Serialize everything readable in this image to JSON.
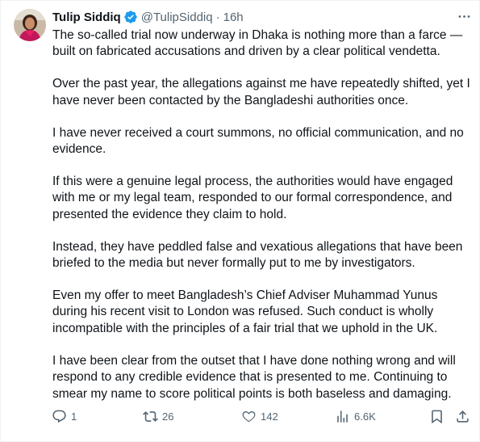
{
  "author": {
    "name": "Tulip Siddiq",
    "handle": "@TulipSiddiq",
    "separator": "·",
    "time": "16h",
    "verified": true
  },
  "icons": {
    "avatar": "profile-photo",
    "verified": "verified-badge-icon",
    "more": "more-options-icon",
    "reply": "reply-icon",
    "retweet": "retweet-icon",
    "like": "heart-icon",
    "views": "views-bar-chart-icon",
    "bookmark": "bookmark-icon",
    "share": "share-icon"
  },
  "colors": {
    "verified": "#1d9bf0",
    "secondary_text": "#536471",
    "primary_text": "#0f1419"
  },
  "tweet": {
    "paragraphs": [
      "The so-called trial now underway in Dhaka is nothing more than a farce — built on fabricated accusations and driven by a clear political vendetta.",
      "Over the past year, the allegations against me have repeatedly shifted, yet I have never been contacted by the Bangladeshi authorities once.",
      "I have never received a court summons, no official communication, and no evidence.",
      "If this were a genuine legal process, the authorities would have engaged with me or my legal team, responded to our formal correspondence, and presented the evidence they claim to hold.",
      "Instead, they have peddled false and vexatious allegations that have been briefed to the media but never formally put to me by investigators.",
      "Even my offer to meet Bangladesh’s Chief Adviser Muhammad Yunus during his recent visit to London was refused. Such conduct is wholly incompatible with the principles of a fair trial that we uphold in the UK.",
      "I have been clear from the outset that I have done nothing wrong and will respond to any credible evidence that is presented to me.  Continuing to smear my name to score political points is both baseless and damaging."
    ]
  },
  "stats": {
    "replies": "1",
    "retweets": "26",
    "likes": "142",
    "views": "6.6K"
  }
}
